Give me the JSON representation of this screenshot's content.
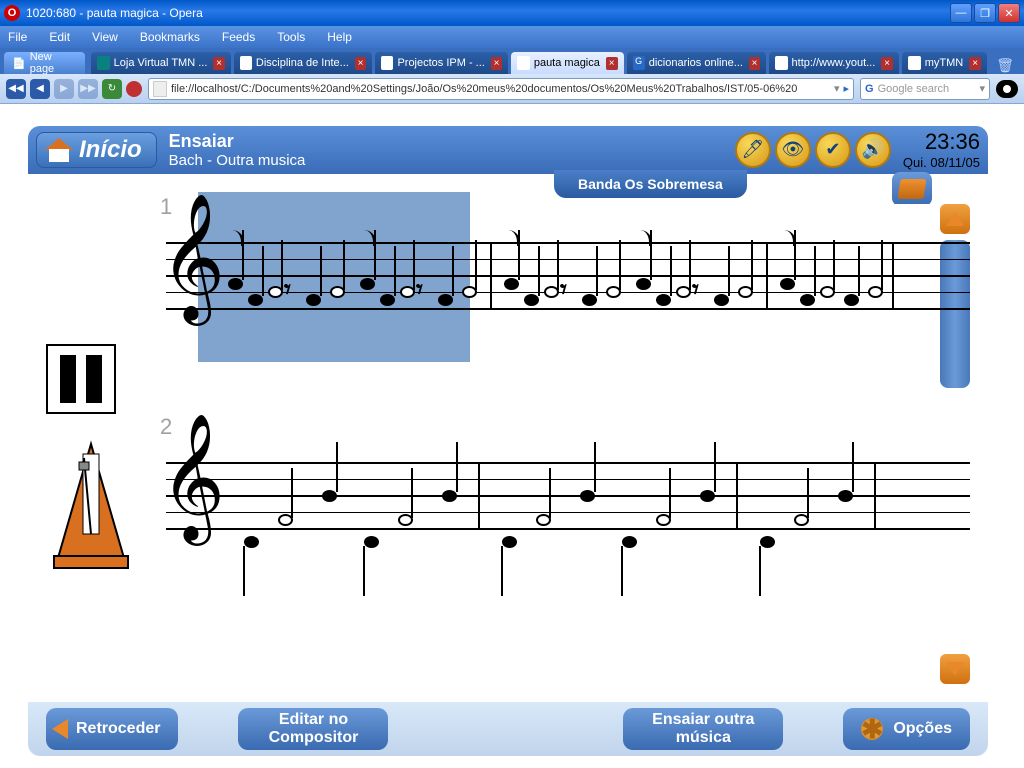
{
  "window": {
    "title": "1020:680 - pauta magica - Opera"
  },
  "menu": {
    "file": "File",
    "edit": "Edit",
    "view": "View",
    "bookmarks": "Bookmarks",
    "feeds": "Feeds",
    "tools": "Tools",
    "help": "Help"
  },
  "tabs": {
    "new": "New page",
    "t1": "Loja Virtual TMN ...",
    "t2": "Disciplina de Inte...",
    "t3": "Projectos IPM - ...",
    "t4": "pauta magica",
    "t5": "dicionarios online...",
    "t6": "http://www.yout...",
    "t7": "myTMN"
  },
  "address": {
    "url": "file://localhost/C:/Documents%20and%20Settings/João/Os%20meus%20documentos/Os%20Meus%20Trabalhos/IST/05-06%20",
    "search_placeholder": "Google search"
  },
  "app": {
    "home": "Início",
    "title": "Ensaiar",
    "subtitle": "Bach - Outra musica",
    "band": "Banda Os Sobremesa",
    "time": "23:36",
    "date": "Qui. 08/11/05",
    "measure1": "1",
    "measure2": "2"
  },
  "footer": {
    "back": "Retroceder",
    "edit": "Editar no Compositor",
    "other": "Ensaiar outra música",
    "options": "Opções"
  },
  "icons": {
    "metronome": "metronome",
    "pause": "pause",
    "eye": "eye",
    "check": "check",
    "speaker": "speaker"
  }
}
